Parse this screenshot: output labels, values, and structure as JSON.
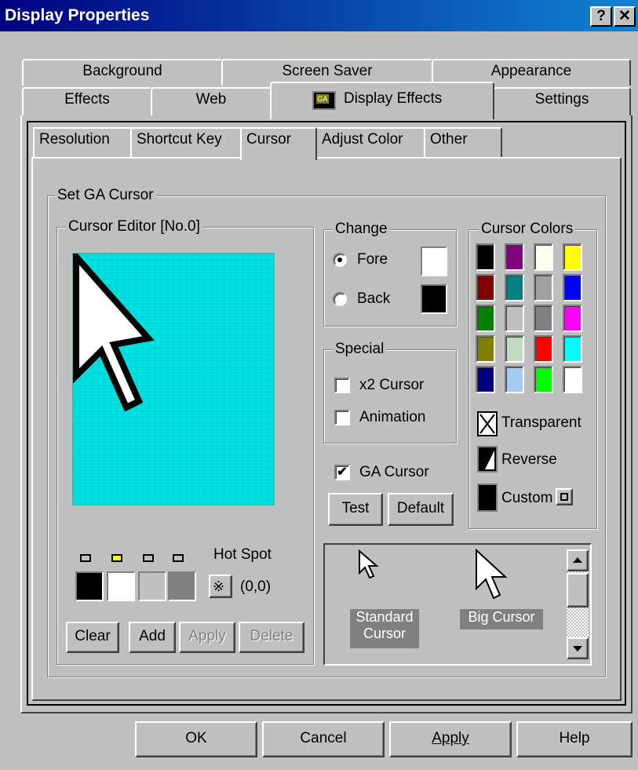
{
  "window": {
    "title": "Display Properties",
    "help_btn": "?",
    "close_btn": "✕"
  },
  "tabs_back": [
    "Background",
    "Screen Saver",
    "Appearance"
  ],
  "tabs_front": [
    "Effects",
    "Web",
    "Display Effects",
    "Settings"
  ],
  "selected_tab": "Display Effects",
  "subtabs": [
    "Resolution",
    "Shortcut Key",
    "Cursor",
    "Adjust Color",
    "Other"
  ],
  "selected_subtab": "Cursor",
  "group_set_cursor": "Set GA Cursor",
  "editor": {
    "title": "Cursor Editor [No.0]",
    "hot_spot_label": "Hot Spot",
    "hot_spot_value": "(0,0)",
    "buttons": {
      "clear": "Clear",
      "add": "Add",
      "apply": "Apply",
      "delete": "Delete"
    },
    "palette_colors": [
      "#000000",
      "#ffffff",
      "#c0c0c0",
      "#808080"
    ],
    "indicator_colors": [
      "#c0c0c0",
      "#ffff00",
      "#c0c0c0",
      "#c0c0c0"
    ]
  },
  "change": {
    "title": "Change",
    "fore": "Fore",
    "back": "Back",
    "fore_color": "#ffffff",
    "back_color": "#000000",
    "selected": "Fore"
  },
  "special": {
    "title": "Special",
    "x2": "x2 Cursor",
    "animation": "Animation",
    "x2_checked": false,
    "animation_checked": false
  },
  "ga_cursor": {
    "label": "GA Cursor",
    "checked": true,
    "check_mark": "✔"
  },
  "test_button": "Test",
  "default_button": "Default",
  "cursor_colors": {
    "title": "Cursor Colors",
    "colors": [
      "#000000",
      "#800080",
      "#fffff0",
      "#ffff00",
      "#800000",
      "#008080",
      "#a0a0a4",
      "#0000ff",
      "#008000",
      "#c0c0c0",
      "#808080",
      "#ff00ff",
      "#808000",
      "#c0dcc0",
      "#ff0000",
      "#00ffff",
      "#000080",
      "#a6caf0",
      "#00ff00",
      "#ffffff"
    ],
    "transparent": "Transparent",
    "reverse": "Reverse",
    "custom": "Custom"
  },
  "preview": {
    "standard": [
      "Standard",
      "Cursor"
    ],
    "big": "Big Cursor"
  },
  "footer": {
    "ok": "OK",
    "cancel": "Cancel",
    "apply": "Apply",
    "help": "Help"
  }
}
